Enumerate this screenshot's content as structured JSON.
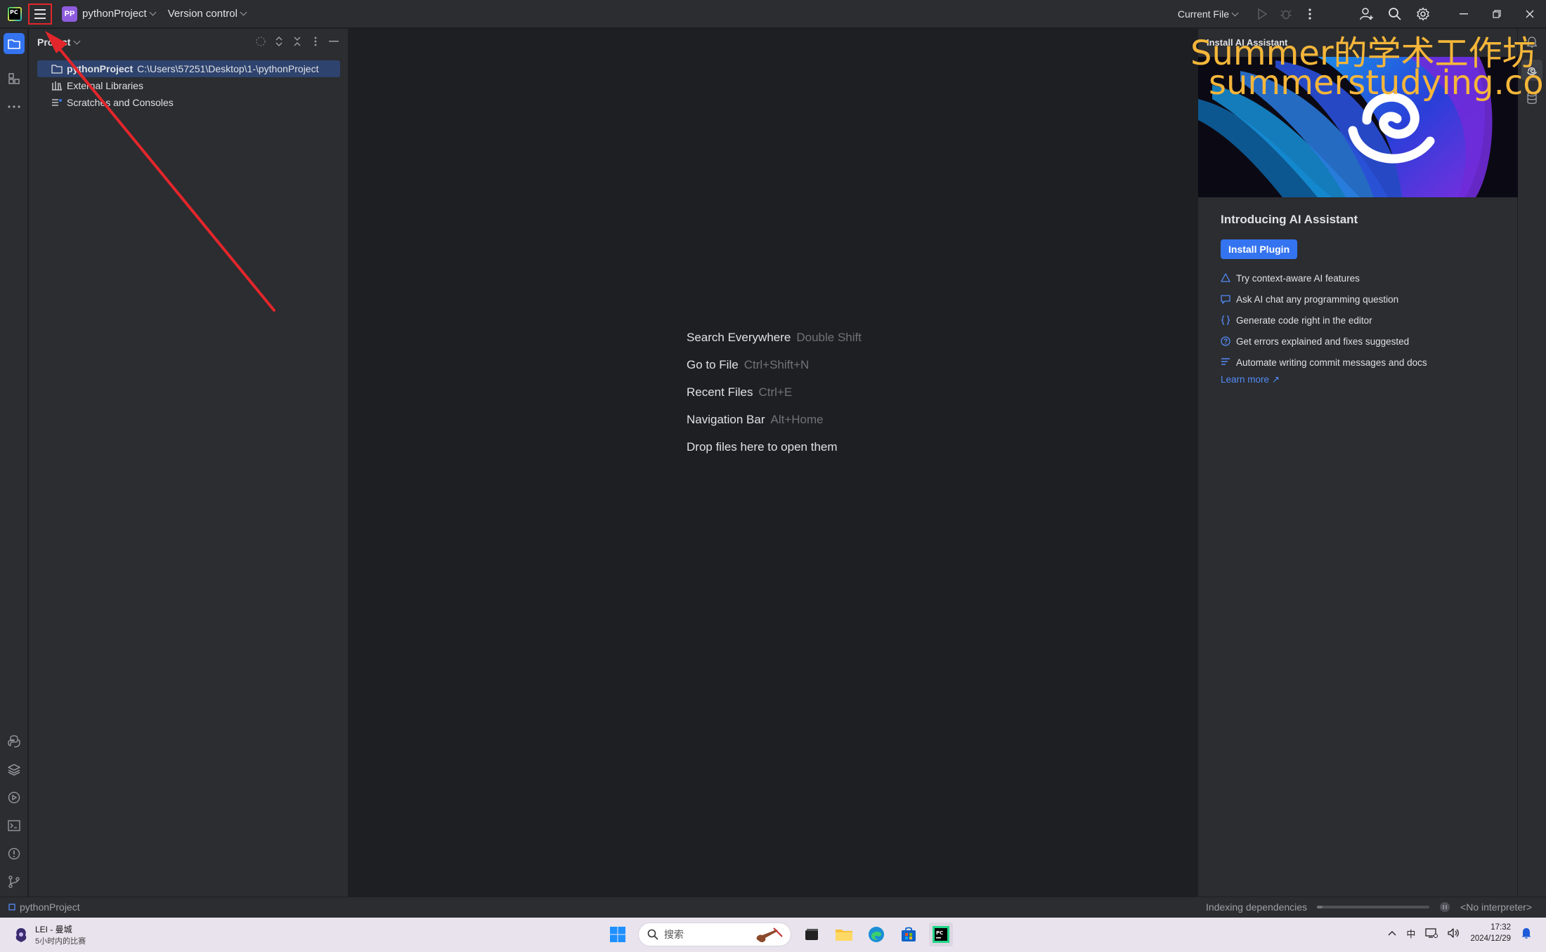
{
  "titlebar": {
    "app_logo": "PC",
    "project_badge": "PP",
    "project_name": "pythonProject",
    "version_control": "Version control",
    "run_config": "Current File"
  },
  "project_panel": {
    "title": "Project",
    "tree": [
      {
        "name": "pythonProject",
        "path": "C:\\Users\\57251\\Desktop\\1-\\pythonProject",
        "icon": "folder-icon"
      },
      {
        "name": "External Libraries",
        "icon": "library-icon"
      },
      {
        "name": "Scratches and Consoles",
        "icon": "scratches-icon"
      }
    ]
  },
  "editor": {
    "hints": [
      {
        "label": "Search Everywhere",
        "shortcut": "Double Shift"
      },
      {
        "label": "Go to File",
        "shortcut": "Ctrl+Shift+N"
      },
      {
        "label": "Recent Files",
        "shortcut": "Ctrl+E"
      },
      {
        "label": "Navigation Bar",
        "shortcut": "Alt+Home"
      },
      {
        "label": "Drop files here to open them",
        "shortcut": ""
      }
    ]
  },
  "ai_panel": {
    "header": "Install AI Assistant",
    "title": "Introducing AI Assistant",
    "install_button": "Install Plugin",
    "features": [
      {
        "text": "Try context-aware AI features",
        "icon": "triangle-icon"
      },
      {
        "text": "Ask AI chat any programming question",
        "icon": "chat-icon"
      },
      {
        "text": "Generate code right in the editor",
        "icon": "braces-icon"
      },
      {
        "text": "Get errors explained and fixes suggested",
        "icon": "question-icon"
      },
      {
        "text": "Automate writing commit messages and docs",
        "icon": "list-icon"
      }
    ],
    "learn_more": "Learn more ↗"
  },
  "watermark": {
    "line1": "Summer的学术工作坊",
    "line2": "summerstudying.com"
  },
  "statusbar": {
    "project": "pythonProject",
    "indexing": "Indexing dependencies",
    "indexing_progress": 0.05,
    "interpreter": "<No interpreter>"
  },
  "taskbar": {
    "weather_title": "LEI - 曼城",
    "weather_sub": "5小时内的比赛",
    "search_placeholder": "搜索",
    "ime": "中",
    "time": "17:32",
    "date": "2024/12/29"
  },
  "colors": {
    "accent": "#3574f0",
    "annotation": "#e3262b",
    "watermark": "#f5b63a"
  }
}
